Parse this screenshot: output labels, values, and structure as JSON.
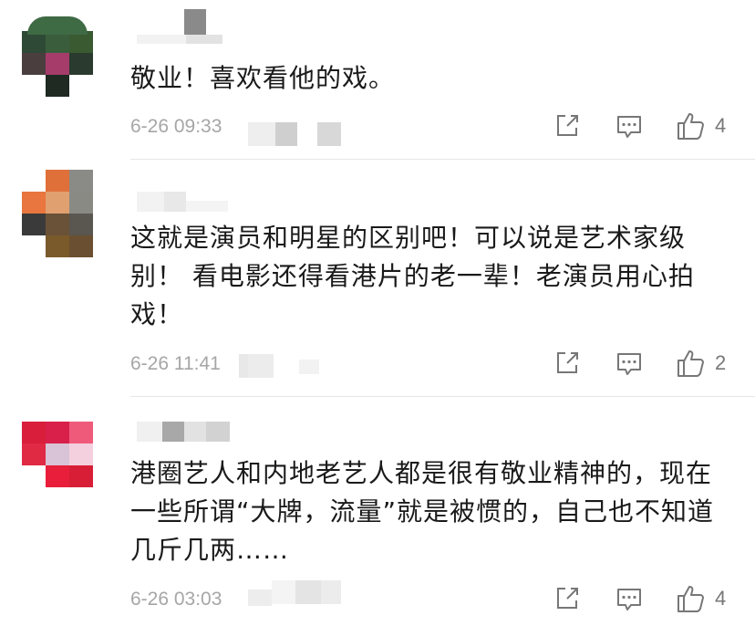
{
  "comments": [
    {
      "text": "敬业！喜欢看他的戏。",
      "time": "6-26 09:33",
      "likes": "4",
      "avatar_colors": [
        "#2e4a36",
        "#3a5e3c",
        "#3a5a32",
        "#4a3e3e",
        "#a63c6a",
        "#2a3a2e",
        "#ffffff",
        "#1e2a22",
        "#ffffff"
      ]
    },
    {
      "text": "这就是演员和明星的区别吧！可以说是艺术家级别！ 看电影还得看港片的老一辈！老演员用心拍戏！",
      "time": "6-26 11:41",
      "likes": "2",
      "avatar_colors": [
        "#ffffff",
        "#e0703a",
        "#8a8a86",
        "#e8763e",
        "#e0a070",
        "#8a8a84",
        "#3a3a3a",
        "#6a5238",
        "#5a5650",
        "#ffffff",
        "#7a5a2a",
        "#6a5030"
      ]
    },
    {
      "text": "港圈艺人和内地老艺人都是很有敬业精神的，现在一些所谓“大牌，流量”就是被惯的，自己也不知道几斤几两……",
      "time": "6-26 03:03",
      "likes": "4",
      "avatar_colors": [
        "#d81e3a",
        "#d8204a",
        "#f05a7a",
        "#e02a44",
        "#d8c4d6",
        "#f4d0de",
        "#ffffff",
        "#e81e3a",
        "#d81e36"
      ]
    }
  ]
}
